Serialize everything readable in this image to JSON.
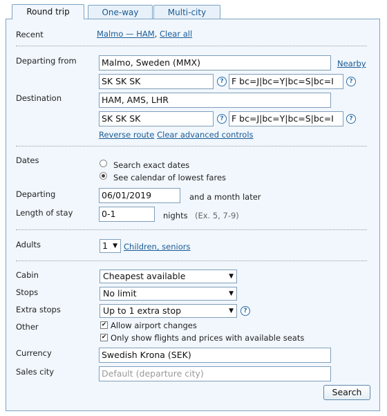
{
  "tabs": {
    "round_trip": "Round trip",
    "one_way": "One-way",
    "multi_city": "Multi-city"
  },
  "recent": {
    "label": "Recent",
    "route": "Malmo — HAM",
    "clear": "Clear all"
  },
  "departing_from": {
    "label": "Departing from",
    "value": "Malmo, Sweden (MMX)",
    "nearby": "Nearby",
    "carriers": "SK SK SK",
    "booking_codes": "F bc=J|bc=Y|bc=S|bc=I"
  },
  "destination": {
    "label": "Destination",
    "value": "HAM, AMS, LHR",
    "carriers": "SK SK SK",
    "booking_codes": "F bc=J|bc=Y|bc=S|bc=I"
  },
  "route_links": {
    "reverse": "Reverse route",
    "clear_advanced": "Clear advanced controls"
  },
  "dates": {
    "label": "Dates",
    "option_exact": "Search exact dates",
    "option_calendar": "See calendar of lowest fares",
    "selected": "calendar"
  },
  "departing": {
    "label": "Departing",
    "value": "06/01/2019",
    "suffix": "and a month later"
  },
  "stay": {
    "label": "Length of stay",
    "value": "0-1",
    "unit": "nights",
    "hint": "(Ex. 5, 7-9)"
  },
  "adults": {
    "label": "Adults",
    "value": "1",
    "link": "Children, seniors"
  },
  "cabin": {
    "label": "Cabin",
    "value": "Cheapest available"
  },
  "stops": {
    "label": "Stops",
    "value": "No limit"
  },
  "extra_stops": {
    "label": "Extra stops",
    "value": "Up to 1 extra stop"
  },
  "other": {
    "label": "Other",
    "option1": "Allow airport changes",
    "option2": "Only show flights and prices with available seats"
  },
  "currency": {
    "label": "Currency",
    "value": "Swedish Krona (SEK)"
  },
  "sales_city": {
    "label": "Sales city",
    "placeholder": "Default (departure city)"
  },
  "search_button": "Search",
  "icons": {
    "help": "?",
    "dropdown": "▼",
    "check": "✔"
  }
}
